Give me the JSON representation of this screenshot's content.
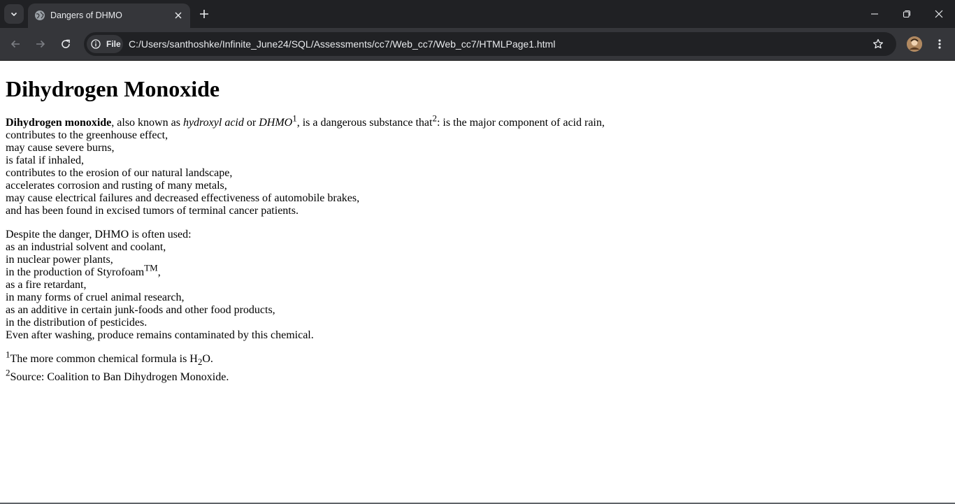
{
  "browser": {
    "tab": {
      "title": "Dangers of DHMO"
    },
    "address_bar": {
      "scheme_label": "File",
      "url": "C:/Users/santhoshke/Infinite_June24/SQL/Assessments/cc7/Web_cc7/Web_cc7/HTMLPage1.html"
    }
  },
  "page": {
    "heading": "Dihydrogen Monoxide",
    "intro": {
      "term": "Dihydrogen monoxide",
      "aka_text": ", also known as ",
      "alias1": "hydroxyl acid",
      "or_text": " or ",
      "alias2": "DHMO",
      "ref1": "1",
      "desc_text": ", is a dangerous substance that",
      "ref2": "2",
      "lead_text": ": is the major component of acid rain,"
    },
    "dangers": [
      "contributes to the greenhouse effect,",
      "may cause severe burns,",
      "is fatal if inhaled,",
      "contributes to the erosion of our natural landscape,",
      "accelerates corrosion and rusting of many metals,",
      "may cause electrical failures and decreased effectiveness of automobile brakes,",
      "and has been found in excised tumors of terminal cancer patients."
    ],
    "uses_intro": "Despite the danger, DHMO is often used:",
    "uses_a": [
      "as an industrial solvent and coolant,",
      "in nuclear power plants,"
    ],
    "styrofoam": {
      "prefix": "in the production of Styrofoam",
      "tm": "TM",
      "suffix": ","
    },
    "uses_b": [
      "as a fire retardant,",
      "in many forms of cruel animal research,",
      "as an additive in certain junk-foods and other food products,",
      "in the distribution of pesticides.",
      "Even after washing, produce remains contaminated by this chemical."
    ],
    "footnotes": {
      "fn1_mark": "1",
      "fn1_text": "The more common chemical formula is H",
      "fn1_sub": "2",
      "fn1_tail": "O.",
      "fn2_mark": "2",
      "fn2_text": "Source: Coalition to Ban Dihydrogen Monoxide."
    }
  }
}
